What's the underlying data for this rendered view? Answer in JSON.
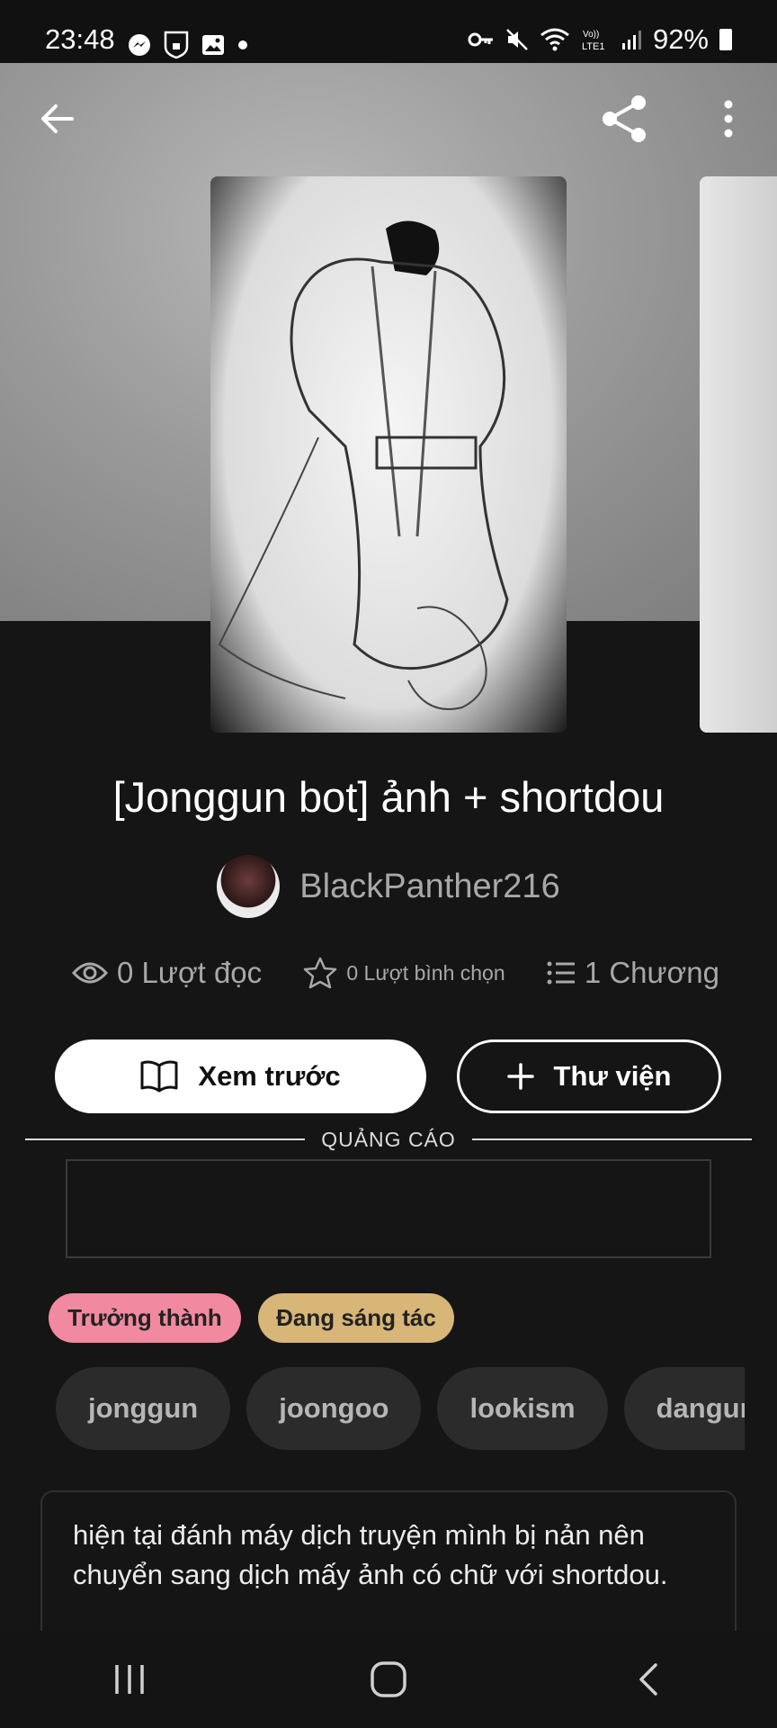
{
  "status_bar": {
    "time": "23:48",
    "battery": "92%",
    "left_icons": [
      "messenger-icon",
      "vpn-icon",
      "gallery-icon",
      "dot-icon"
    ],
    "right_icons": [
      "key-icon",
      "mute-icon",
      "wifi-icon",
      "lte-icon",
      "signal-icon",
      "battery-icon"
    ]
  },
  "header": {
    "back_icon": "back-arrow-icon",
    "share_icon": "share-icon",
    "menu_icon": "more-vertical-icon"
  },
  "story": {
    "title": "[Jonggun bot] ảnh + shortdou",
    "author": "BlackPanther216",
    "stats": {
      "reads": "0 Lượt đọc",
      "votes": "0 Lượt bình chọn",
      "chapters": "1 Chương"
    }
  },
  "actions": {
    "preview_label": "Xem trước",
    "library_label": "Thư viện"
  },
  "ad": {
    "label": "QUẢNG CÁO"
  },
  "badges": [
    "Trưởng thành",
    "Đang sáng tác"
  ],
  "colors": {
    "mature_badge": "#f18aa0",
    "ongoing_badge": "#d8b678",
    "background": "#151515"
  },
  "tags": [
    "jonggun",
    "joongoo",
    "lookism",
    "dangun"
  ],
  "description": "hiện tại đánh máy dịch truyện mình bị nản nên chuyển sang dịch mấy ảnh có chữ với shortdou."
}
